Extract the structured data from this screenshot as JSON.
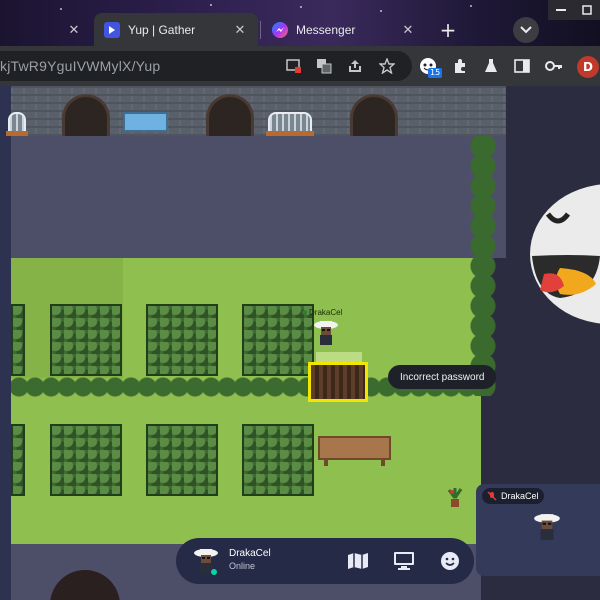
{
  "browser": {
    "tabs": [
      {
        "label": "",
        "active": false
      },
      {
        "label": "Yup | Gather",
        "active": true
      },
      {
        "label": "Messenger",
        "active": false
      }
    ],
    "url_prefix": "kjTwR9YguIVWMylX",
    "url_path": "/Yup",
    "extension_badge": "15",
    "profile_initial": "D",
    "icons": [
      "tab-close-icon",
      "new-tab-icon",
      "tab-search-icon",
      "blocked-popup-icon",
      "translate-icon",
      "share-icon",
      "bookmark-star-icon",
      "extension-icon",
      "puzzle-icon",
      "lab-flask-icon",
      "sidebar-icon",
      "key-icon"
    ]
  },
  "game": {
    "player_name_tag": "DrakaCel",
    "door_tooltip": "Incorrect password",
    "video_tile": {
      "name": "DrakaCel",
      "mic_muted": true
    },
    "statusbar": {
      "name": "DrakaCel",
      "status": "Online",
      "status_color": "#06d6a0",
      "buttons": [
        "map-icon",
        "screen-share-icon",
        "emoji-icon"
      ]
    }
  },
  "colors": {
    "accent_yellow": "#f2e600",
    "statusbar_bg": "#252a47",
    "grass": "#8fbf4e"
  }
}
